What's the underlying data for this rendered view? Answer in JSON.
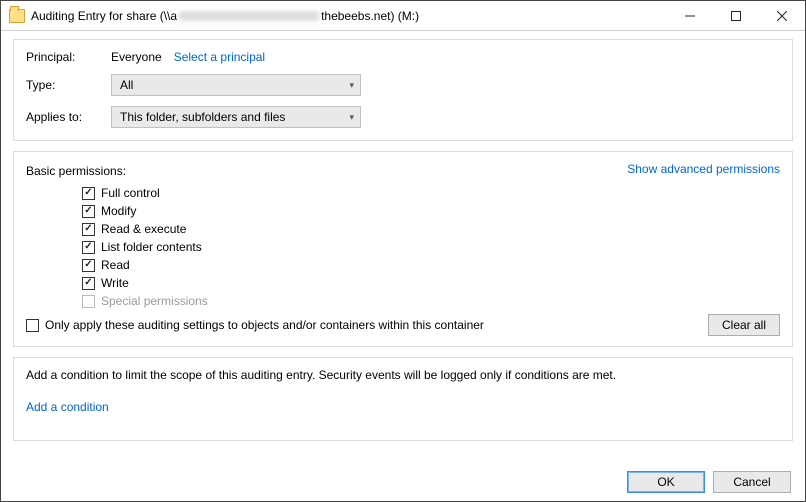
{
  "titlebar": {
    "prefix": "Auditing Entry for share (\\\\a",
    "suffix": "thebeebs.net) (M:)"
  },
  "principal": {
    "label": "Principal:",
    "value": "Everyone",
    "select_link": "Select a principal"
  },
  "type": {
    "label": "Type:",
    "value": "All"
  },
  "applies": {
    "label": "Applies to:",
    "value": "This folder, subfolders and files"
  },
  "permissions": {
    "title": "Basic permissions:",
    "advanced_link": "Show advanced permissions",
    "items": [
      {
        "label": "Full control",
        "checked": true,
        "disabled": false
      },
      {
        "label": "Modify",
        "checked": true,
        "disabled": false
      },
      {
        "label": "Read & execute",
        "checked": true,
        "disabled": false
      },
      {
        "label": "List folder contents",
        "checked": true,
        "disabled": false
      },
      {
        "label": "Read",
        "checked": true,
        "disabled": false
      },
      {
        "label": "Write",
        "checked": true,
        "disabled": false
      },
      {
        "label": "Special permissions",
        "checked": false,
        "disabled": true
      }
    ],
    "only_within": "Only apply these auditing settings to objects and/or containers within this container",
    "clear": "Clear all"
  },
  "condition": {
    "text": "Add a condition to limit the scope of this auditing entry. Security events will be logged only if conditions are met.",
    "add_link": "Add a condition"
  },
  "buttons": {
    "ok": "OK",
    "cancel": "Cancel"
  }
}
